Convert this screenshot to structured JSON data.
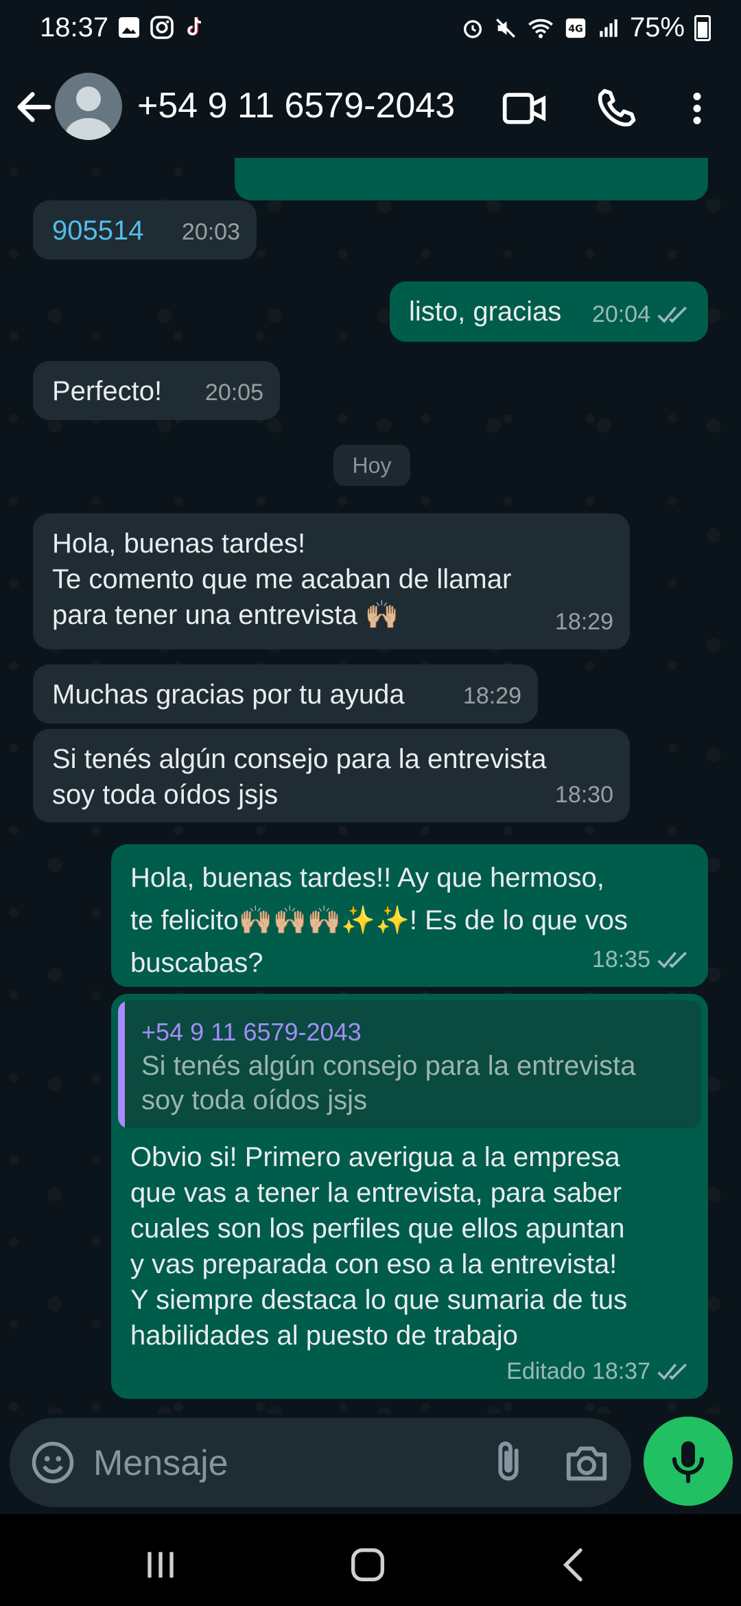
{
  "status_bar": {
    "time": "18:37",
    "battery_pct": "75%",
    "left_icons": [
      "gallery-icon",
      "instagram-icon",
      "tiktok-icon"
    ],
    "right_icons": [
      "alarm-icon",
      "mute-icon",
      "wifi-icon",
      "volte-icon",
      "signal-icon",
      "battery-icon"
    ]
  },
  "header": {
    "contact": "+54 9 11 6579-2043"
  },
  "messages": [
    {
      "side": "in",
      "text": "905514",
      "time": "20:03",
      "is_link": true
    },
    {
      "side": "out",
      "text": "listo, gracias",
      "time": "20:04",
      "read": true
    },
    {
      "side": "in",
      "text": "Perfecto!",
      "time": "20:05"
    },
    {
      "side": "in",
      "text": "Hola, buenas tardes!\nTe comento que me acaban de llamar\npara tener una entrevista 🙌🏼",
      "time": "18:29"
    },
    {
      "side": "in",
      "text": "Muchas gracias por tu ayuda",
      "time": "18:29"
    },
    {
      "side": "in",
      "text": "Si tenés algún consejo para la entrevista\nsoy toda oídos jsjs",
      "time": "18:30"
    },
    {
      "side": "out",
      "text": "Hola, buenas tardes!! Ay que hermoso,\nte felicito🙌🏼🙌🏼🙌🏼✨✨! Es de lo que vos\nbuscabas?",
      "time": "18:35",
      "read": true
    },
    {
      "side": "out",
      "text": "Obvio si! Primero averigua a la empresa\nque vas a tener la entrevista, para saber\ncuales son los perfiles que ellos apuntan\ny vas preparada con eso a la entrevista!\nY siempre destaca lo que sumaria de tus\nhabilidades al puesto de trabajo",
      "time": "Editado 18:37",
      "read": true,
      "quote": {
        "name": "+54 9 11 6579-2043",
        "text": "Si tenés algún consejo para la entrevista\nsoy toda oídos jsjs"
      }
    }
  ],
  "day_separator": "Hoy",
  "input": {
    "placeholder": "Mensaje"
  },
  "colors": {
    "background": "#0b141a",
    "incoming_bubble": "#202c33",
    "outgoing_bubble": "#005c4b",
    "accent_green": "#21c063",
    "link": "#53bdeb",
    "quote_accent": "#a88cff"
  }
}
